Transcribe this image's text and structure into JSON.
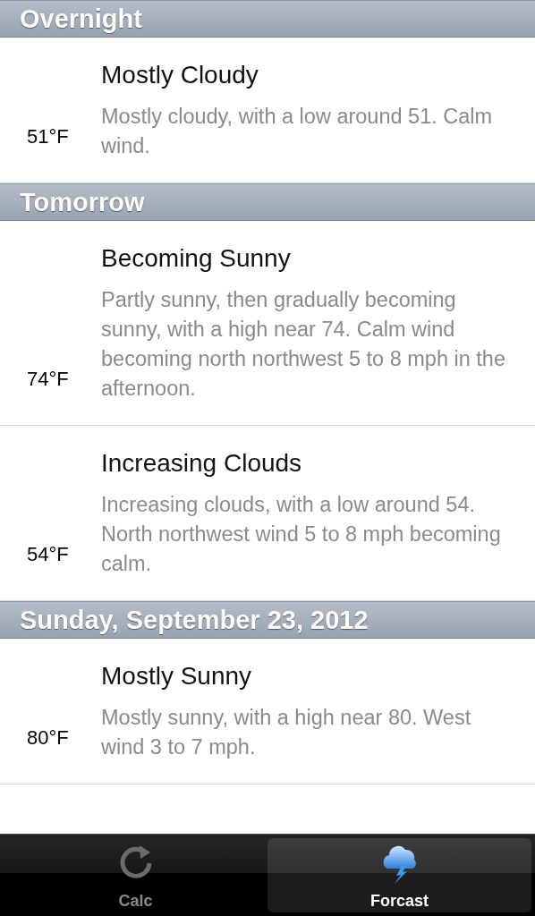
{
  "sections": [
    {
      "title": "Overnight",
      "periods": [
        {
          "condition": "Mostly Cloudy",
          "temperature": "51°F",
          "description": "Mostly cloudy, with a low around 51. Calm wind."
        }
      ]
    },
    {
      "title": "Tomorrow",
      "periods": [
        {
          "condition": "Becoming Sunny",
          "temperature": "74°F",
          "description": "Partly sunny, then gradually becoming sunny, with a high near 74. Calm wind becoming north northwest 5 to 8 mph in the afternoon."
        },
        {
          "condition": "Increasing Clouds",
          "temperature": "54°F",
          "description": "Increasing clouds, with a low around 54. North northwest wind 5 to 8 mph becoming calm."
        }
      ]
    },
    {
      "title": "Sunday, September 23, 2012",
      "periods": [
        {
          "condition": "Mostly Sunny",
          "temperature": "80°F",
          "description": "Mostly sunny, with a high near 80. West wind 3 to 7 mph."
        }
      ]
    }
  ],
  "tab_bar": [
    {
      "label": "Calc",
      "kind": "refresh",
      "selected": false
    },
    {
      "label": "Forcast",
      "kind": "storm",
      "selected": true
    }
  ]
}
